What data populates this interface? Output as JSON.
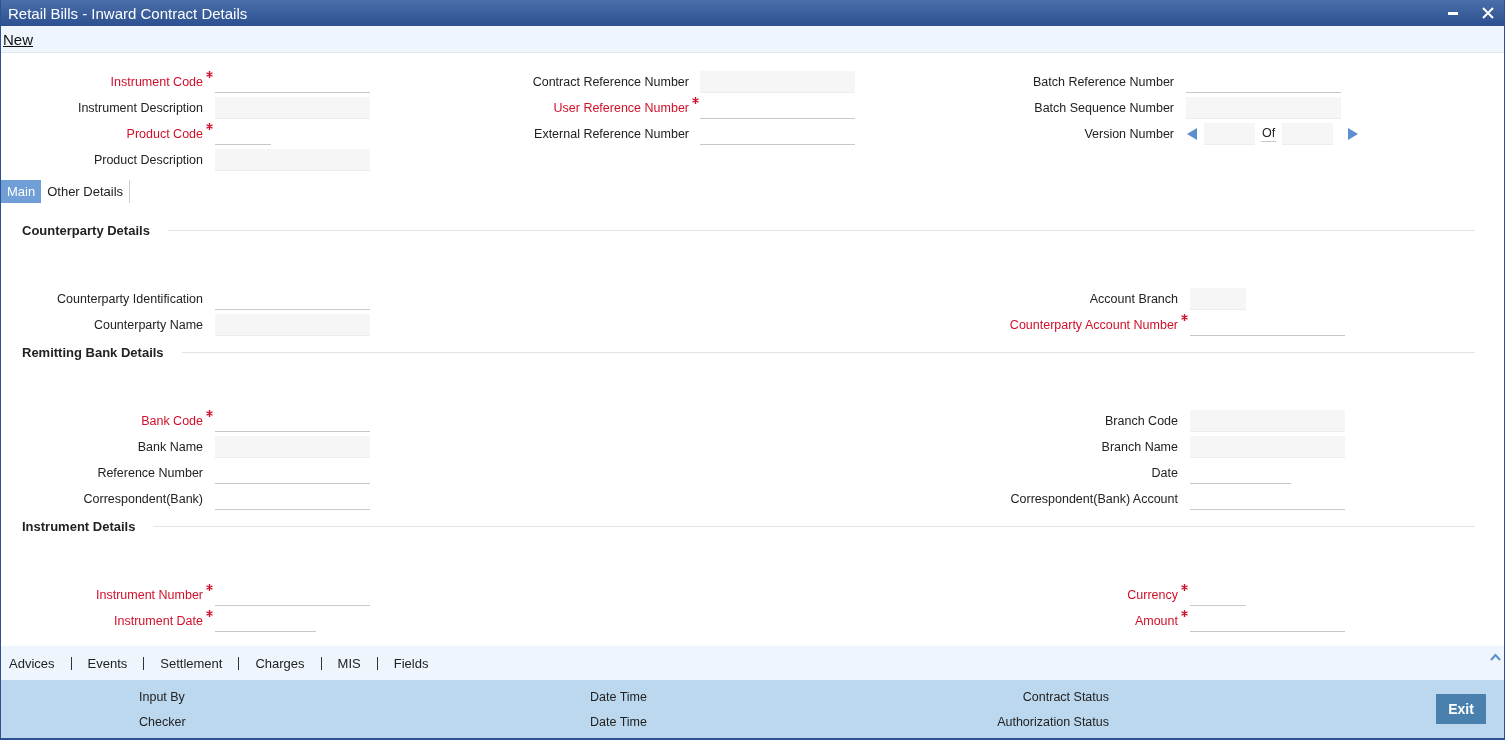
{
  "window": {
    "title": "Retail Bills - Inward Contract Details"
  },
  "toolbar": {
    "actions": [
      {
        "label": "New"
      }
    ]
  },
  "header": {
    "columns": [
      [
        {
          "label": "Instrument Code",
          "required": true,
          "kind": "input"
        },
        {
          "label": "Instrument Description",
          "required": false,
          "kind": "display"
        },
        {
          "label": "Product Code",
          "required": true,
          "kind": "short_input"
        },
        {
          "label": "Product Description",
          "required": false,
          "kind": "display"
        }
      ],
      [
        {
          "label": "Contract Reference Number",
          "required": false,
          "kind": "display"
        },
        {
          "label": "User Reference Number",
          "required": true,
          "kind": "input"
        },
        {
          "label": "External Reference Number",
          "required": false,
          "kind": "input"
        }
      ],
      [
        {
          "label": "Batch Reference Number",
          "required": false,
          "kind": "input"
        },
        {
          "label": "Batch Sequence Number",
          "required": false,
          "kind": "display"
        },
        {
          "label": "Version Number",
          "required": false,
          "kind": "version",
          "of_label": "Of"
        }
      ]
    ]
  },
  "tabs": [
    {
      "label": "Main",
      "selected": true
    },
    {
      "label": "Other Details",
      "selected": false
    }
  ],
  "sections": [
    {
      "title": "Counterparty Details",
      "left": [
        {
          "label": "Counterparty Identification",
          "required": false,
          "kind": "input"
        },
        {
          "label": "Counterparty Name",
          "required": false,
          "kind": "display"
        }
      ],
      "right": [
        {
          "label": "Account Branch",
          "required": false,
          "kind": "short_display"
        },
        {
          "label": "Counterparty Account Number",
          "required": true,
          "kind": "input"
        }
      ]
    },
    {
      "title": "Remitting Bank Details",
      "left": [
        {
          "label": "Bank Code",
          "required": true,
          "kind": "input"
        },
        {
          "label": "Bank Name",
          "required": false,
          "kind": "display"
        },
        {
          "label": "Reference Number",
          "required": false,
          "kind": "input"
        },
        {
          "label": "Correspondent(Bank)",
          "required": false,
          "kind": "input"
        }
      ],
      "right": [
        {
          "label": "Branch Code",
          "required": false,
          "kind": "display"
        },
        {
          "label": "Branch Name",
          "required": false,
          "kind": "display"
        },
        {
          "label": "Date",
          "required": false,
          "kind": "date_input"
        },
        {
          "label": "Correspondent(Bank) Account",
          "required": false,
          "kind": "input"
        }
      ]
    },
    {
      "title": "Instrument Details",
      "left": [
        {
          "label": "Instrument Number",
          "required": true,
          "kind": "input"
        },
        {
          "label": "Instrument Date",
          "required": true,
          "kind": "date_input"
        }
      ],
      "right": [
        {
          "label": "Currency",
          "required": true,
          "kind": "short_input"
        },
        {
          "label": "Amount",
          "required": true,
          "kind": "input"
        }
      ]
    }
  ],
  "links": [
    {
      "label": "Advices"
    },
    {
      "label": "Events"
    },
    {
      "label": "Settlement"
    },
    {
      "label": "Charges"
    },
    {
      "label": "MIS"
    },
    {
      "label": "Fields"
    }
  ],
  "audit": [
    [
      "Input By",
      "Date Time",
      "Contract Status"
    ],
    [
      "Checker",
      "Date Time",
      "Authorization Status"
    ]
  ],
  "buttons": [
    {
      "label": "Exit"
    }
  ]
}
